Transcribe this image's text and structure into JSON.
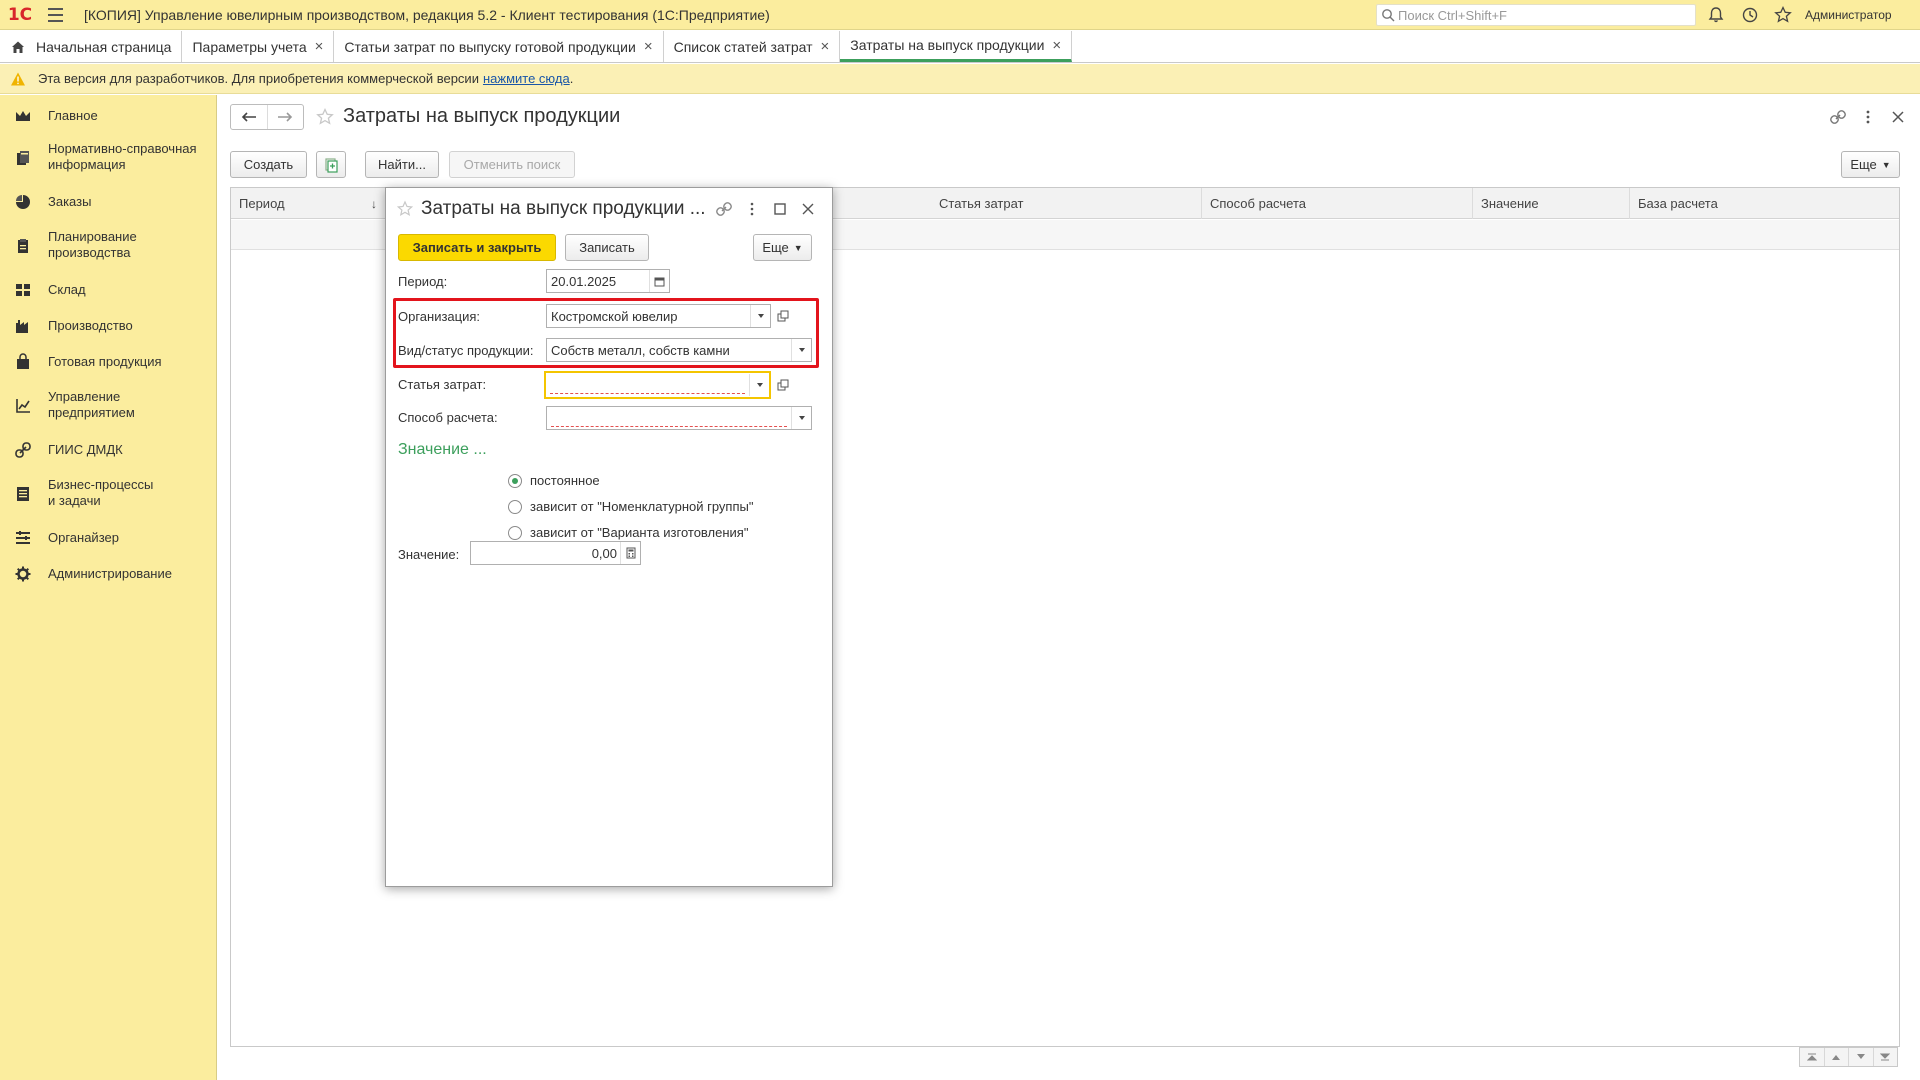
{
  "titlebar": {
    "logo": "1С",
    "title": "[КОПИЯ] Управление ювелирным производством, редакция 5.2  - Клиент тестирования (1С:Предприятие)",
    "search_placeholder": "Поиск Ctrl+Shift+F",
    "user": "Администратор"
  },
  "tabs": [
    {
      "label": "Начальная страница"
    },
    {
      "label": "Параметры учета"
    },
    {
      "label": "Статьи затрат по выпуску готовой продукции"
    },
    {
      "label": "Список статей затрат"
    },
    {
      "label": "Затраты на выпуск продукции"
    }
  ],
  "infobar": {
    "text": "Эта версия для разработчиков. Для приобретения коммерческой версии",
    "link": "нажмите сюда",
    "tail": "."
  },
  "sidebar": {
    "items": [
      {
        "label": "Главное",
        "icon": "crown-icon"
      },
      {
        "label": "Нормативно-справочная\nинформация",
        "icon": "books-icon"
      },
      {
        "label": "Заказы",
        "icon": "pie-chart-icon"
      },
      {
        "label": "Планирование\nпроизводства",
        "icon": "clipboard-icon"
      },
      {
        "label": "Склад",
        "icon": "grid-icon"
      },
      {
        "label": "Производство",
        "icon": "factory-icon"
      },
      {
        "label": "Готовая продукция",
        "icon": "bag-icon"
      },
      {
        "label": "Управление\nпредприятием",
        "icon": "chart-icon"
      },
      {
        "label": "ГИИС ДМДК",
        "icon": "link-icon"
      },
      {
        "label": "Бизнес-процессы\nи задачи",
        "icon": "tasks-icon"
      },
      {
        "label": "Органайзер",
        "icon": "organizer-icon"
      },
      {
        "label": "Администрирование",
        "icon": "gear-icon"
      }
    ]
  },
  "main": {
    "title": "Затраты на выпуск продукции",
    "toolbar": {
      "create": "Создать",
      "find": "Найти...",
      "cancel_search": "Отменить поиск",
      "more": "Еще"
    },
    "columns": [
      "Период",
      "Статья затрат",
      "Способ расчета",
      "Значение",
      "База расчета"
    ],
    "sort_indicator": "↓"
  },
  "dialog": {
    "title": "Затраты на выпуск продукции ...",
    "save_close": "Записать и закрыть",
    "save": "Записать",
    "more": "Еще",
    "period_label": "Период:",
    "period_value": "20.01.2025",
    "org_label": "Организация:",
    "org_value": "Костромской ювелир",
    "product_label": "Вид/статус продукции:",
    "product_value": "Собств металл, собств камни",
    "cost_item_label": "Статья затрат:",
    "cost_item_value": "",
    "calc_method_label": "Способ расчета:",
    "calc_method_value": "",
    "value_section": "Значение ...",
    "options": [
      {
        "label": "постоянное",
        "checked": true
      },
      {
        "label": "зависит от \"Номенклатурной группы\"",
        "checked": false
      },
      {
        "label": "зависит от \"Варианта изготовления\"",
        "checked": false
      }
    ],
    "value_label": "Значение:",
    "value_value": "0,00"
  },
  "colors": {
    "titlebar_bg": "#fbed9e",
    "sidebar_bg": "#fbed9e",
    "accent_green": "#3c9f5c",
    "primary_button": "#fbd900",
    "highlight_red": "#e3141c"
  }
}
